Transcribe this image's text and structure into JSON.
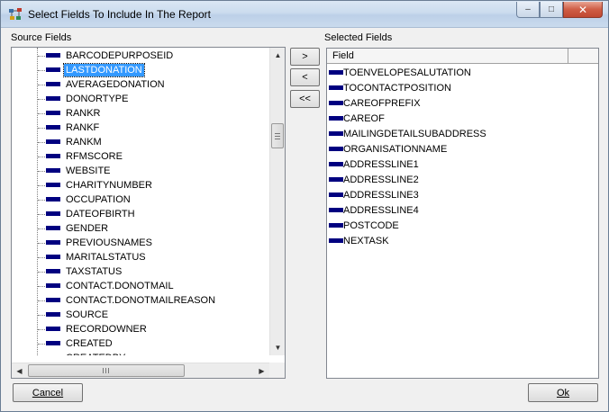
{
  "window": {
    "title": "Select Fields To Include In The Report"
  },
  "window_controls": {
    "minimize": "‒",
    "maximize": "□",
    "close": "✕"
  },
  "source": {
    "label": "Source Fields",
    "items": [
      "BARCODEPURPOSEID",
      "LASTDONATION",
      "AVERAGEDONATION",
      "DONORTYPE",
      "RANKR",
      "RANKF",
      "RANKM",
      "RFMSCORE",
      "WEBSITE",
      "CHARITYNUMBER",
      "OCCUPATION",
      "DATEOFBIRTH",
      "GENDER",
      "PREVIOUSNAMES",
      "MARITALSTATUS",
      "TAXSTATUS",
      "CONTACT.DONOTMAIL",
      "CONTACT.DONOTMAILREASON",
      "SOURCE",
      "RECORDOWNER",
      "CREATED",
      "CREATEDBY"
    ],
    "selected_item": "LASTDONATION"
  },
  "move_buttons": {
    "add": ">",
    "remove": "<",
    "remove_all": "<<"
  },
  "selected": {
    "label": "Selected Fields",
    "column_header": "Field",
    "items": [
      "TOENVELOPESALUTATION",
      "TOCONTACTPOSITION",
      "CAREOFPREFIX",
      "CAREOF",
      "MAILINGDETAILSUBADDRESS",
      "ORGANISATIONNAME",
      "ADDRESSLINE1",
      "ADDRESSLINE2",
      "ADDRESSLINE3",
      "ADDRESSLINE4",
      "POSTCODE",
      "NEXTASK"
    ]
  },
  "footer": {
    "cancel_label": "Cancel",
    "ok_label": "Ok"
  },
  "colors": {
    "field_icon": "#000080",
    "selection": "#3399ff"
  }
}
